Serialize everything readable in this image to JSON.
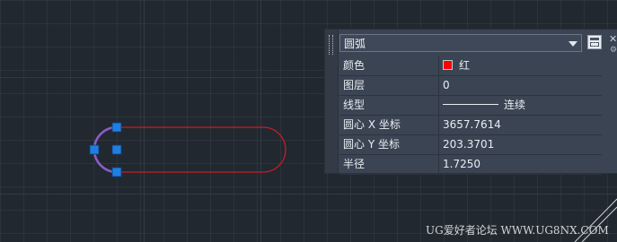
{
  "colors": {
    "background": "#212830",
    "arc_selected": "#8a5cc4",
    "entity_red": "#cc1b24",
    "grip_blue": "#1f7fe0"
  },
  "properties": {
    "object_type": "圆弧",
    "rows": [
      {
        "name": "颜色",
        "value": "红",
        "swatch_color": "#ff0000"
      },
      {
        "name": "图层",
        "value": "0"
      },
      {
        "name": "线型",
        "value": "连续",
        "linetype_sample": true
      },
      {
        "name": "圆心 X 坐标",
        "value": "3657.7614"
      },
      {
        "name": "圆心 Y 坐标",
        "value": "203.3701"
      },
      {
        "name": "半径",
        "value": "1.7250"
      }
    ],
    "icons": {
      "dropdown": "chevron-down-icon",
      "quick_select": "quick-select-icon",
      "grip": "palette-grip-icon"
    }
  },
  "watermark": "UG爱好者论坛 WWW.UG8NX.COM"
}
